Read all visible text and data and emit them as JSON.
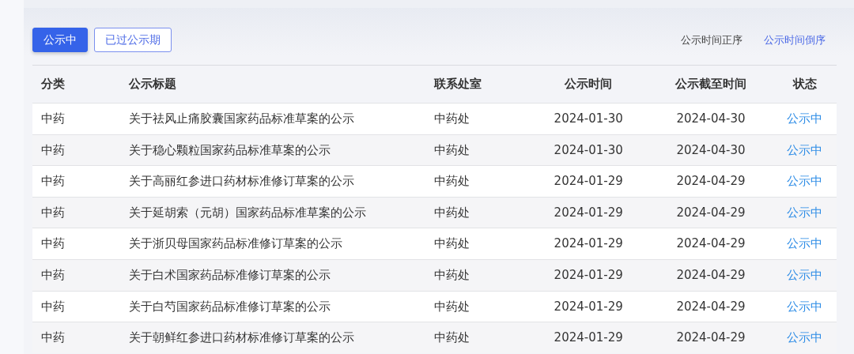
{
  "tabs": [
    {
      "label": "公示中",
      "selected": true
    },
    {
      "label": "已过公示期",
      "selected": false
    }
  ],
  "sort_options": [
    {
      "label": "公示时间正序",
      "selected": false
    },
    {
      "label": "公示时间倒序",
      "selected": true
    }
  ],
  "table": {
    "columns": [
      "分类",
      "公示标题",
      "联系处室",
      "公示时间",
      "公示截至时间",
      "状态"
    ],
    "rows": [
      [
        "中药",
        "关于祛风止痛胶囊国家药品标准草案的公示",
        "中药处",
        "2024-01-30",
        "2024-04-30",
        "公示中"
      ],
      [
        "中药",
        "关于稳心颗粒国家药品标准草案的公示",
        "中药处",
        "2024-01-30",
        "2024-04-30",
        "公示中"
      ],
      [
        "中药",
        "关于高丽红参进口药材标准修订草案的公示",
        "中药处",
        "2024-01-29",
        "2024-04-29",
        "公示中"
      ],
      [
        "中药",
        "关于延胡索（元胡）国家药品标准草案的公示",
        "中药处",
        "2024-01-29",
        "2024-04-29",
        "公示中"
      ],
      [
        "中药",
        "关于浙贝母国家药品标准修订草案的公示",
        "中药处",
        "2024-01-29",
        "2024-04-29",
        "公示中"
      ],
      [
        "中药",
        "关于白术国家药品标准修订草案的公示",
        "中药处",
        "2024-01-29",
        "2024-04-29",
        "公示中"
      ],
      [
        "中药",
        "关于白芍国家药品标准修订草案的公示",
        "中药处",
        "2024-01-29",
        "2024-04-29",
        "公示中"
      ],
      [
        "中药",
        "关于朝鲜红参进口药材标准修订草案的公示",
        "中药处",
        "2024-01-29",
        "2024-04-29",
        "公示中"
      ]
    ]
  }
}
